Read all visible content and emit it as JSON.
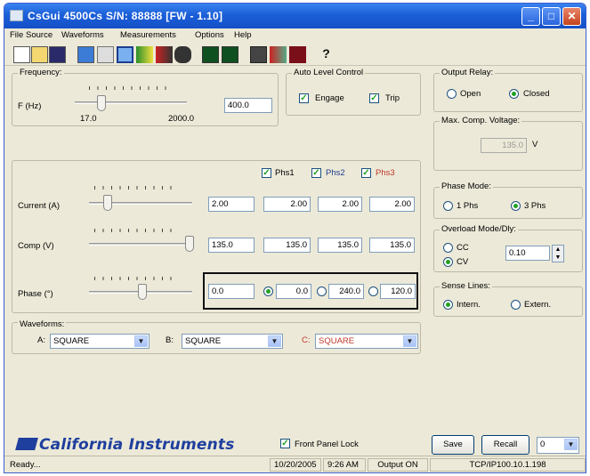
{
  "window": {
    "title": "CsGui   4500Cs S/N: 88888 [FW - 1.10]",
    "minimize": "_",
    "maximize": "□",
    "close": "✕"
  },
  "menu": [
    "File",
    "Source",
    "Waveforms",
    "Measurements",
    "Options",
    "Help"
  ],
  "toolbar": [
    "new-file-icon",
    "open-folder-icon",
    "save-disk-icon",
    "window-icon",
    "list-icon",
    "select-icon",
    "bar-icon",
    "wave-icon",
    "binoculars-icon",
    "waveform-green-icon",
    "waveform-green2-icon",
    "display-icon",
    "bars-chart-icon",
    "red-chart-icon",
    "help-icon"
  ],
  "frequency": {
    "label": "Frequency:",
    "f_label": "F (Hz)",
    "min": "17.0",
    "max": "2000.0",
    "value": "400.0"
  },
  "alc": {
    "label": "Auto Level Control",
    "engage": "Engage",
    "trip": "Trip"
  },
  "relay": {
    "label": "Output Relay:",
    "open": "Open",
    "closed": "Closed",
    "selected": "Closed"
  },
  "max_comp": {
    "label": "Max. Comp. Voltage:",
    "value": "135.0",
    "unit": "V"
  },
  "phases": {
    "phs1": "Phs1",
    "phs2": "Phs2",
    "phs3": "Phs3",
    "phs3_color": "#c0392b"
  },
  "current": {
    "label": "Current (A)",
    "value": "2.00",
    "p1": "2.00",
    "p2": "2.00",
    "p3": "2.00"
  },
  "comp": {
    "label": "Comp (V)",
    "value": "135.0",
    "p1": "135.0",
    "p2": "135.0",
    "p3": "135.0"
  },
  "phase": {
    "label": "Phase (°)",
    "value": "0.0",
    "p1": "0.0",
    "p2": "240.0",
    "p3": "120.0"
  },
  "phase_mode": {
    "label": "Phase Mode:",
    "one": "1 Phs",
    "three": "3 Phs",
    "selected": "3 Phs"
  },
  "overload": {
    "label": "Overload Mode/Dly:",
    "cc": "CC",
    "cv": "CV",
    "value": "0.10",
    "selected": "CV"
  },
  "sense": {
    "label": "Sense Lines:",
    "intern": "Intern.",
    "extern": "Extern.",
    "selected": "Intern."
  },
  "waveforms": {
    "label": "Waveforms:",
    "a_label": "A:",
    "a": "SQUARE",
    "b_label": "B:",
    "b": "SQUARE",
    "c_label": "C:",
    "c": "SQUARE"
  },
  "footer": {
    "logo": "California Instruments",
    "front_panel_lock": "Front Panel Lock",
    "save": "Save",
    "recall": "Recall",
    "recall_value": "0"
  },
  "status": {
    "ready": "Ready...",
    "date": "10/20/2005",
    "time": "9:26 AM",
    "output": "Output ON",
    "address": "TCP/IP100.10.1.198"
  }
}
